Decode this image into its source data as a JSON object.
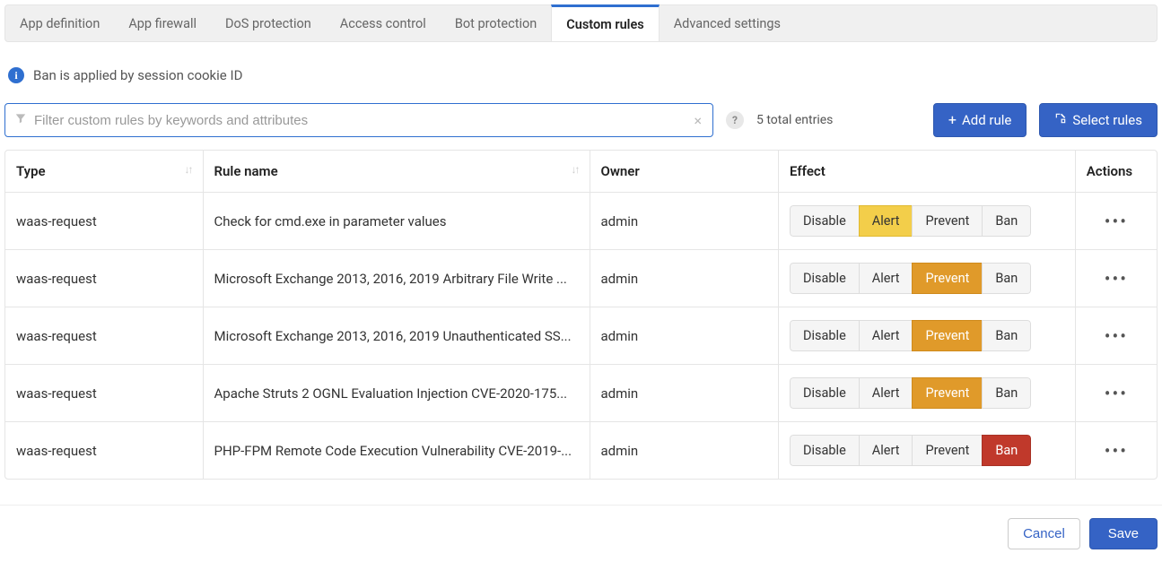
{
  "tabs": [
    {
      "label": "App definition",
      "active": false
    },
    {
      "label": "App firewall",
      "active": false
    },
    {
      "label": "DoS protection",
      "active": false
    },
    {
      "label": "Access control",
      "active": false
    },
    {
      "label": "Bot protection",
      "active": false
    },
    {
      "label": "Custom rules",
      "active": true
    },
    {
      "label": "Advanced settings",
      "active": false
    }
  ],
  "info_message": "Ban is applied by session cookie ID",
  "search": {
    "placeholder": "Filter custom rules by keywords and attributes",
    "value": ""
  },
  "total_entries": "5 total entries",
  "buttons": {
    "add_rule": "Add rule",
    "select_rules": "Select rules",
    "cancel": "Cancel",
    "save": "Save"
  },
  "table": {
    "headers": {
      "type": "Type",
      "rule_name": "Rule name",
      "owner": "Owner",
      "effect": "Effect",
      "actions": "Actions"
    },
    "effect_options": [
      "Disable",
      "Alert",
      "Prevent",
      "Ban"
    ],
    "rows": [
      {
        "type": "waas-request",
        "rule_name": "Check for cmd.exe in parameter values",
        "owner": "admin",
        "effect": "Alert"
      },
      {
        "type": "waas-request",
        "rule_name": "Microsoft Exchange 2013, 2016, 2019 Arbitrary File Write ...",
        "owner": "admin",
        "effect": "Prevent"
      },
      {
        "type": "waas-request",
        "rule_name": "Microsoft Exchange 2013, 2016, 2019 Unauthenticated SS...",
        "owner": "admin",
        "effect": "Prevent"
      },
      {
        "type": "waas-request",
        "rule_name": "Apache Struts 2 OGNL Evaluation Injection CVE-2020-175...",
        "owner": "admin",
        "effect": "Prevent"
      },
      {
        "type": "waas-request",
        "rule_name": "PHP-FPM Remote Code Execution Vulnerability CVE-2019-...",
        "owner": "admin",
        "effect": "Ban"
      }
    ]
  }
}
